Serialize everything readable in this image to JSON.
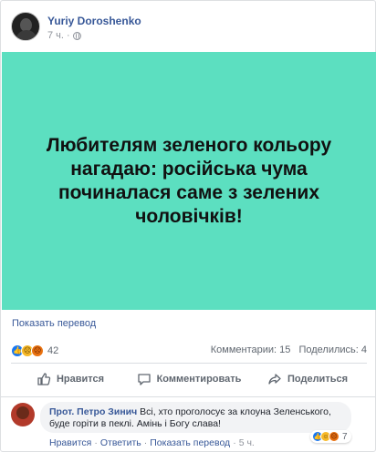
{
  "post": {
    "author": "Yuriy Doroshenko",
    "time": "7 ч.",
    "text": "Любителям зеленого кольору нагадаю: російська чума починалася саме з зелених чоловічків!",
    "image_bg": "#5cdfc0",
    "translate": "Показать перевод"
  },
  "stats": {
    "reactions_count": "42",
    "comments": "Комментарии: 15",
    "shares": "Поделились: 4",
    "reaction_icons": [
      "like-icon",
      "sad-icon",
      "angry-icon"
    ]
  },
  "actions": {
    "like": "Нравится",
    "comment": "Комментировать",
    "share": "Поделиться"
  },
  "comment": {
    "author": "Прот. Петро Зинич",
    "text": " Всі, хто проголосує за клоуна Зеленського, буде горіти в пеклі. Амінь і Богу слава!",
    "reactions_count": "7",
    "like": "Нравится",
    "reply": "Ответить",
    "translate": "Показать перевод",
    "time": "5 ч."
  },
  "colors": {
    "link": "#385898",
    "secondary": "#606770",
    "like": "#1877f2",
    "accent_green": "#5cdfc0"
  }
}
